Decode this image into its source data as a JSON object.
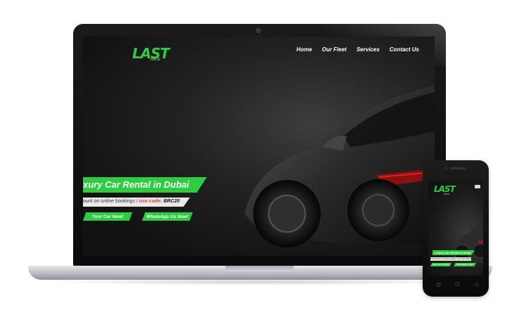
{
  "site": {
    "logo_text": "LAST",
    "logo_sub": "RACE",
    "nav": [
      "Home",
      "Our Fleet",
      "Services",
      "Contact Us"
    ],
    "hero_title": "xury Car Rental in Dubai",
    "promo_prefix": "ount on online bookings / ",
    "promo_code_label": "use code:",
    "promo_code": "BRC20",
    "rent_button": "Your Car Now!",
    "whatsapp_button": "WhatsApp Us Now!"
  },
  "phone": {
    "logo_text": "LAST",
    "logo_sub": "RACE",
    "hero_title": "Luxury Car Rental in Dubai",
    "promo_text": "10% discount on online bookings / use code: BRC20",
    "rent_button": "Rent Your Car Now!",
    "whatsapp_button": "WhatsApp Us Now!",
    "buttons": [
      "◎",
      "⏻",
      "◁"
    ]
  },
  "colors": {
    "accent": "#2ecc40",
    "promo_code_label": "#e53935",
    "screen_bg": "#1b1b1b"
  }
}
